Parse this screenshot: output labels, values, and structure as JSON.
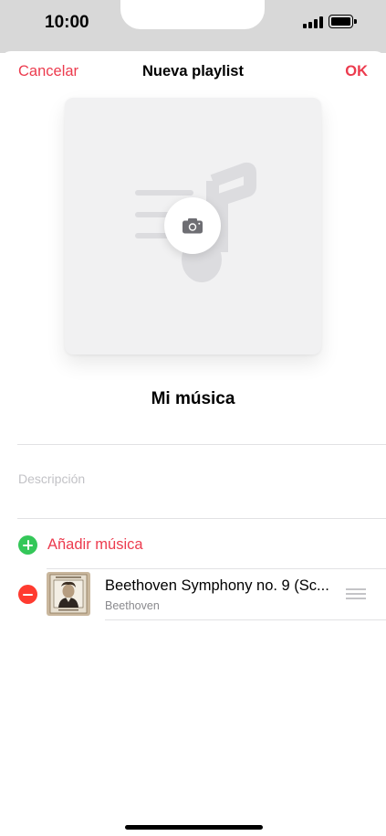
{
  "status_bar": {
    "time": "10:00",
    "signal_icon": "cellular-signal-icon",
    "battery_icon": "battery-icon",
    "battery_level": 1.0
  },
  "nav": {
    "cancel_label": "Cancelar",
    "title": "Nueva playlist",
    "done_label": "OK"
  },
  "artwork": {
    "placeholder_icon": "music-note-icon",
    "camera_icon": "camera-icon"
  },
  "playlist": {
    "name": "Mi música",
    "description_placeholder": "Descripción",
    "description_value": ""
  },
  "add_music": {
    "label": "Añadir música",
    "icon": "plus-circle-icon"
  },
  "songs": [
    {
      "title": "Beethoven Symphony no. 9 (Sc...",
      "artist": "Beethoven",
      "remove_icon": "minus-circle-icon",
      "reorder_icon": "drag-handle-icon"
    }
  ],
  "colors": {
    "accent": "#ec3b4e",
    "add": "#34c759",
    "remove": "#ff3b30",
    "status_bar_bg": "#d8d8d8",
    "artwork_bg": "#f1f1f2"
  }
}
